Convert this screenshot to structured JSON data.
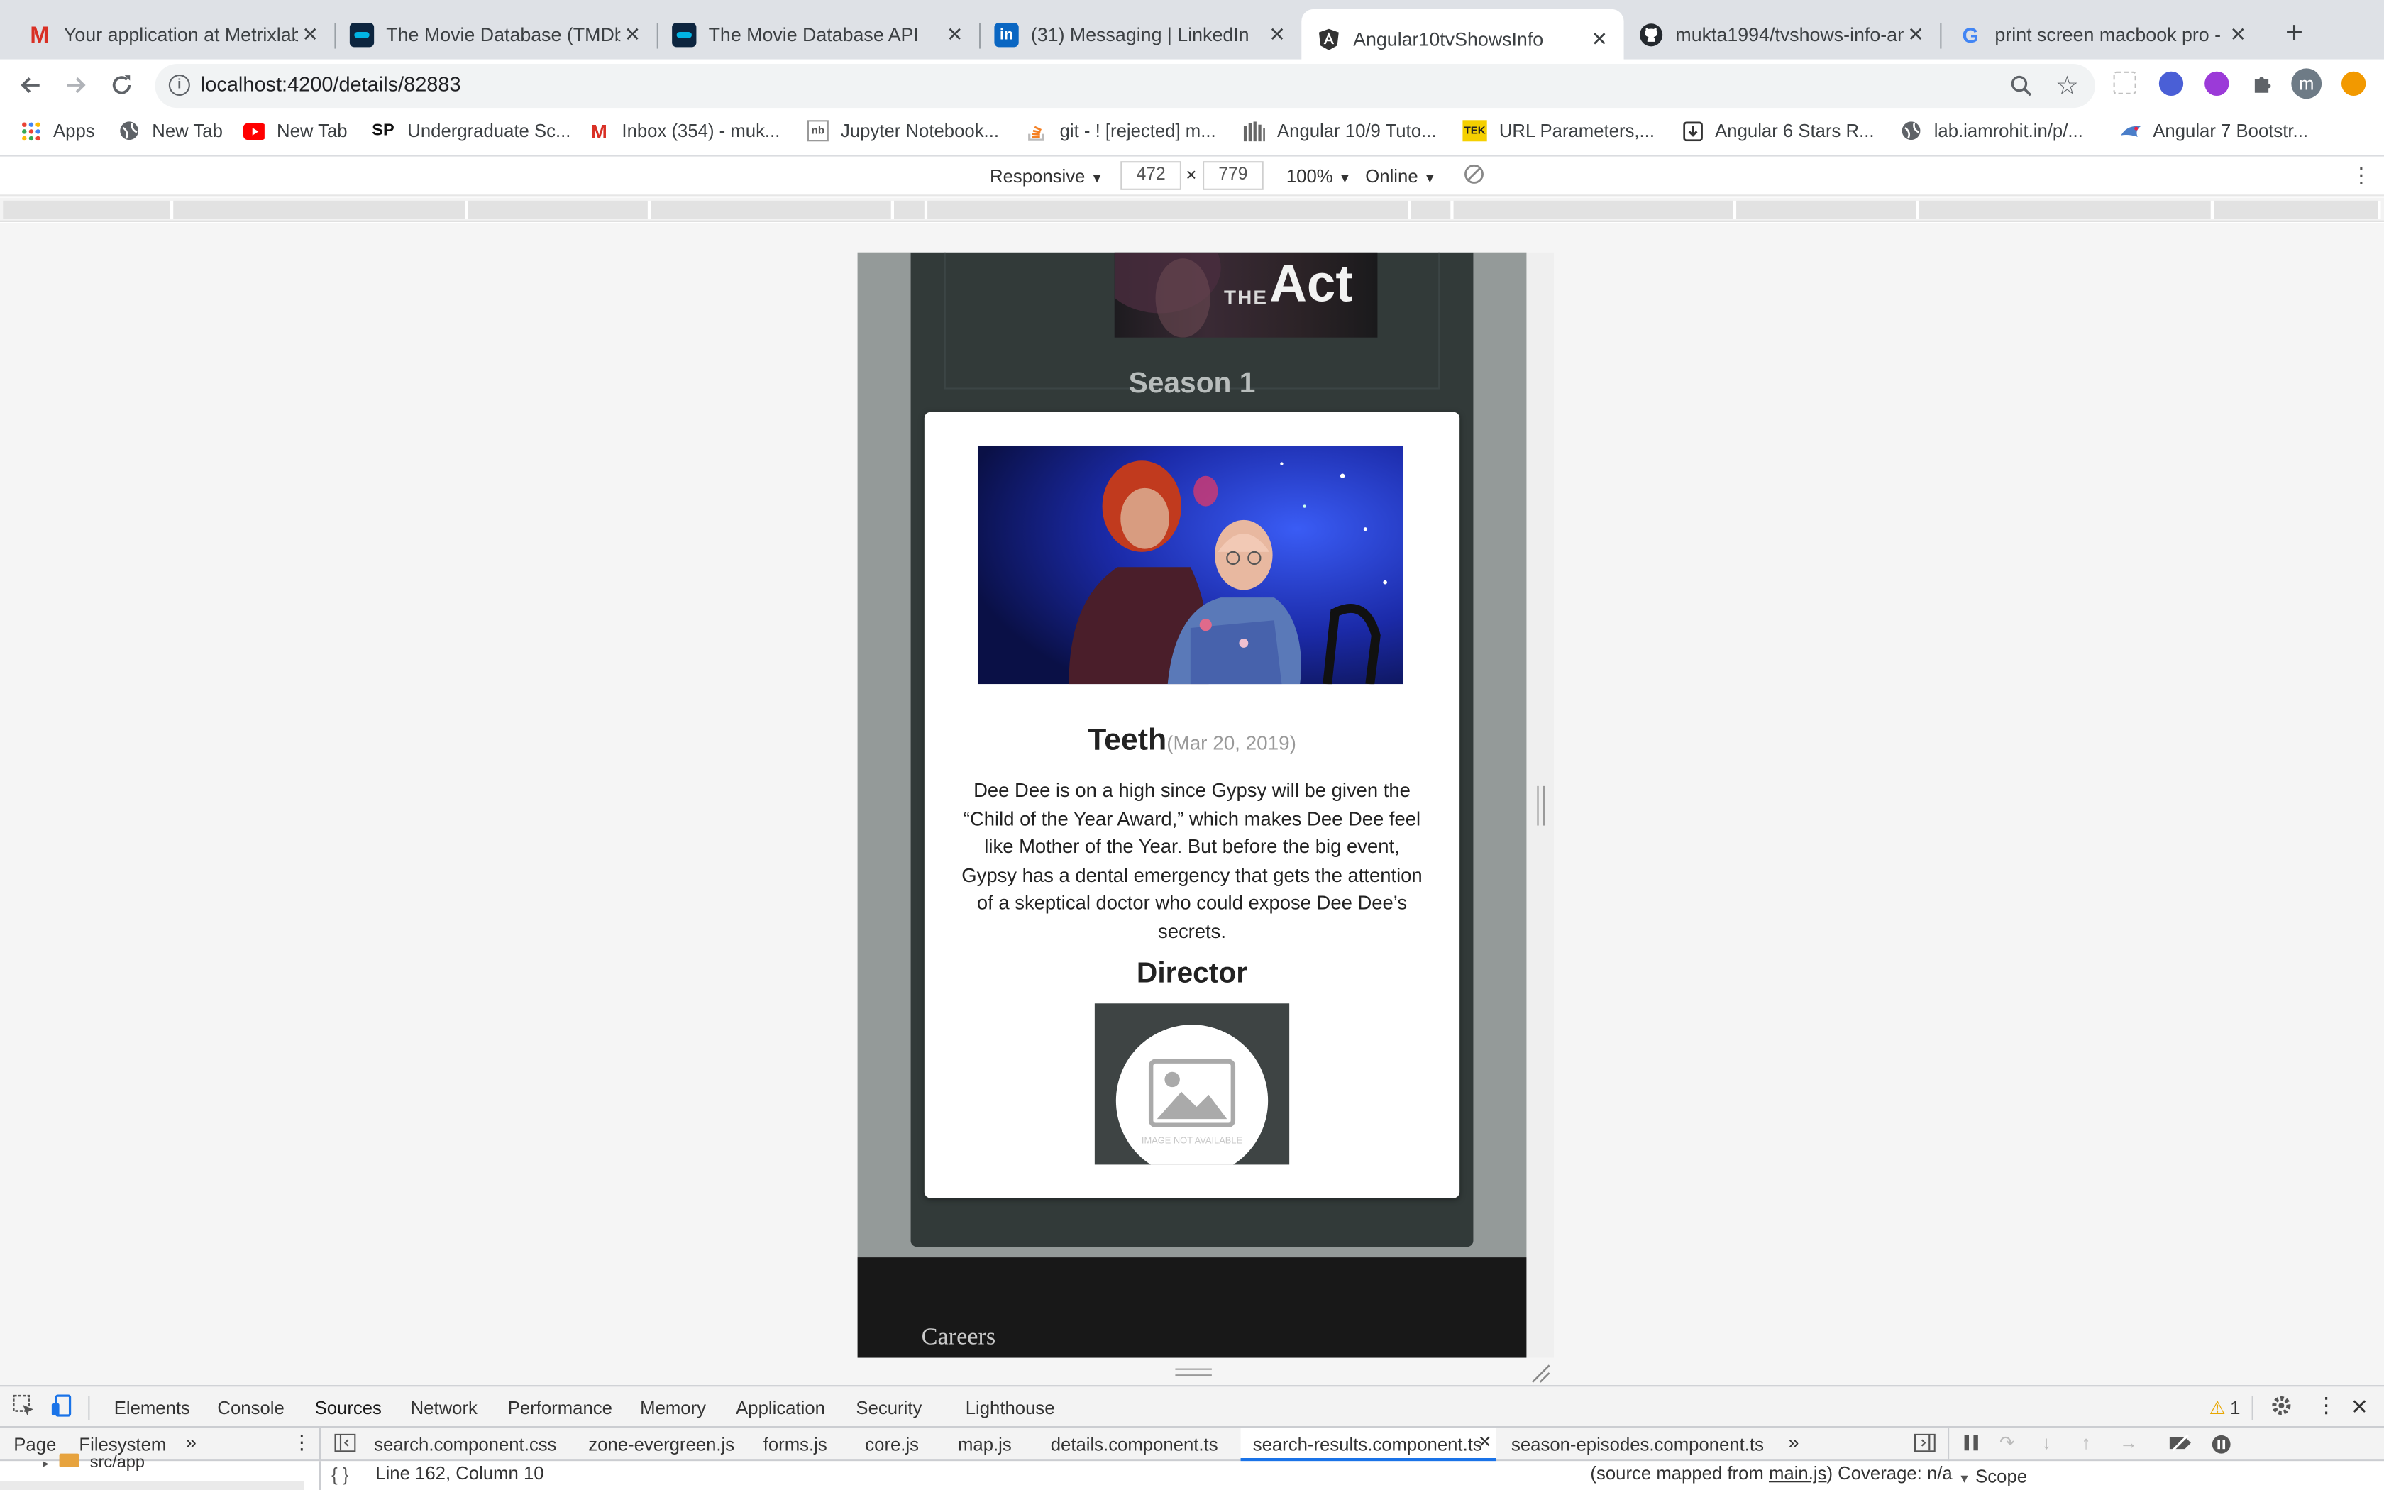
{
  "browser": {
    "tabs": [
      {
        "title": "Your application at Metrixlab",
        "icon": "gmail-icon"
      },
      {
        "title": "The Movie Database (TMDb)",
        "icon": "tmdb-icon"
      },
      {
        "title": "The Movie Database API",
        "icon": "tmdb-icon"
      },
      {
        "title": "(31) Messaging | LinkedIn",
        "icon": "linkedin-icon"
      },
      {
        "title": "Angular10tvShowsInfo",
        "icon": "angular-icon"
      },
      {
        "title": "mukta1994/tvshows-info-an",
        "icon": "github-icon"
      },
      {
        "title": "print screen macbook pro - G",
        "icon": "google-icon"
      }
    ],
    "active_tab": 4,
    "url": "localhost:4200/details/82883",
    "profile_initial": "m",
    "bookmarks": [
      {
        "label": "Apps"
      },
      {
        "label": "New Tab"
      },
      {
        "label": "New Tab"
      },
      {
        "label": "Undergraduate Sc..."
      },
      {
        "label": "Inbox (354) - muk..."
      },
      {
        "label": "Jupyter Notebook..."
      },
      {
        "label": "git - ! [rejected] m..."
      },
      {
        "label": "Angular 10/9 Tuto..."
      },
      {
        "label": "URL Parameters,..."
      },
      {
        "label": "Angular 6 Stars R..."
      },
      {
        "label": "lab.iamrohit.in/p/..."
      },
      {
        "label": "Angular 7 Bootstr..."
      }
    ]
  },
  "device_toolbar": {
    "mode": "Responsive",
    "width": "472",
    "times": "×",
    "height": "779",
    "zoom": "100%",
    "network": "Online"
  },
  "page": {
    "poster_the": "THE",
    "poster_act": "Act",
    "season_title": "Season 1",
    "episode": {
      "name": "Teeth",
      "date": "(Mar 20, 2019)",
      "overview": "Dee Dee is on a high since Gypsy will be given the “Child of the Year Award,” which makes Dee Dee feel like Mother of the Year. But before the big event, Gypsy has a dental emergency that gets the attention of a skeptical doctor who could expose Dee Dee’s secrets."
    },
    "director_heading": "Director",
    "director_image_text": "IMAGE NOT AVAILABLE",
    "footer_link": "Careers"
  },
  "devtools": {
    "tabs": [
      "Elements",
      "Console",
      "Sources",
      "Network",
      "Performance",
      "Memory",
      "Application",
      "Security",
      "Lighthouse"
    ],
    "active_tab": "Sources",
    "warning_count": "1",
    "navigator_tabs": [
      "Page",
      "Filesystem"
    ],
    "tree_item": "src/app",
    "files": [
      "search.component.css",
      "zone-evergreen.js",
      "forms.js",
      "core.js",
      "map.js",
      "details.component.ts",
      "search-results.component.ts",
      "season-episodes.component.ts"
    ],
    "active_file": "search-results.component.ts",
    "cursor_position": "Line 162, Column 10",
    "source_map_prefix": "(source mapped from ",
    "source_map_file": "main.js",
    "source_map_suffix": ")",
    "coverage": "Coverage: n/a",
    "scope_label": "Scope"
  }
}
